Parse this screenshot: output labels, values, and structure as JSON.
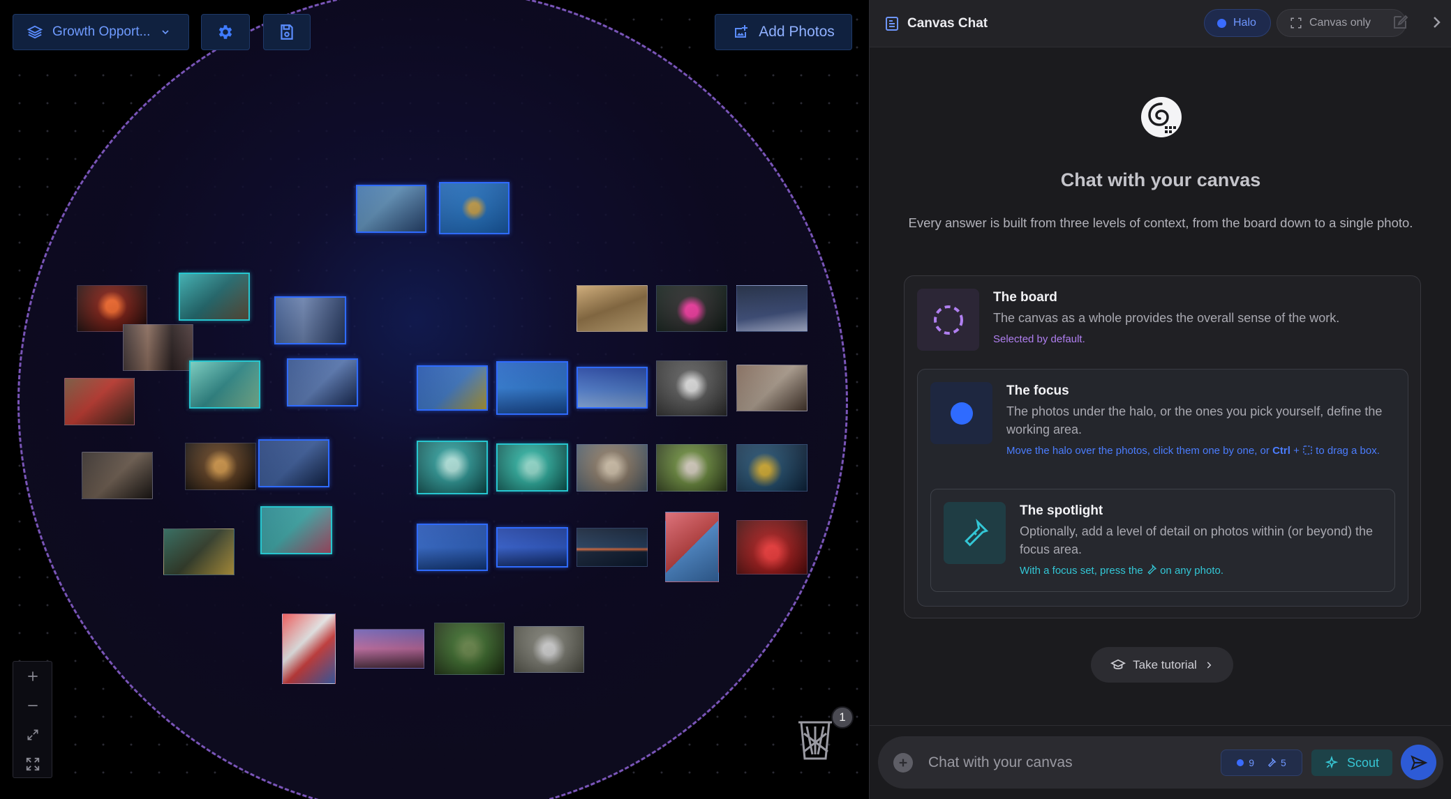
{
  "canvas": {
    "board_select_label": "Growth Opport...",
    "add_photos_label": "Add Photos",
    "trash_count": "1"
  },
  "panel": {
    "title": "Canvas Chat",
    "halo_label": "Halo",
    "canvas_only_label": "Canvas only",
    "hero_title": "Chat with your canvas",
    "hero_subtitle": "Every answer is built from three levels of context, from the board down to a single photo.",
    "board": {
      "title": "The board",
      "desc": "The canvas as a whole provides the overall sense of the work.",
      "hint": "Selected by default."
    },
    "focus": {
      "title": "The focus",
      "desc": "The photos under the halo, or the ones you pick yourself, define the working area.",
      "hint_a": "Move the halo over the photos, click them one by one, or ",
      "hint_b": "Ctrl",
      "hint_c": " + ",
      "hint_d": " to drag a box."
    },
    "spotlight": {
      "title": "The spotlight",
      "desc": "Optionally, add a level of detail on photos within (or beyond) the focus area.",
      "hint_a": "With a focus set, press the ",
      "hint_b": " on any photo."
    },
    "tutorial_label": "Take tutorial",
    "composer": {
      "placeholder": "Chat with your canvas",
      "focus_count": "9",
      "spot_count": "5",
      "scout_label": "Scout"
    }
  },
  "colors": {
    "accent_blue": "#2f6bff",
    "accent_purple": "#b07ff0",
    "accent_teal": "#33c7d6"
  }
}
